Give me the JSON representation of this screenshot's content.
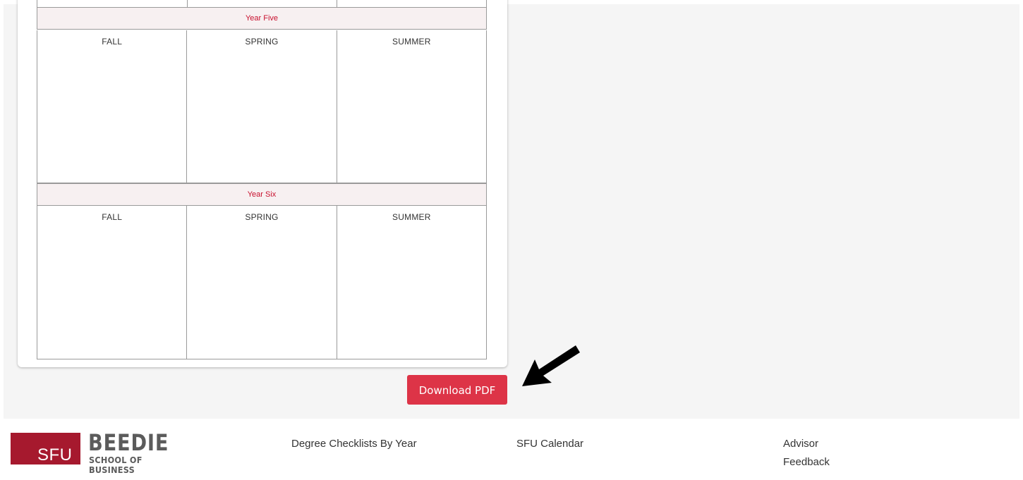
{
  "planner": {
    "years": [
      {
        "label": "Year Five",
        "terms": [
          "FALL",
          "SPRING",
          "SUMMER"
        ]
      },
      {
        "label": "Year Six",
        "terms": [
          "FALL",
          "SPRING",
          "SUMMER"
        ]
      }
    ]
  },
  "actions": {
    "download_label": "Download PDF"
  },
  "footer": {
    "logo": {
      "block_text": "SFU",
      "name": "BEEDIE",
      "subtitle": "SCHOOL OF BUSINESS"
    },
    "links": {
      "degree_checklists": "Degree Checklists By Year",
      "sfu_calendar": "SFU Calendar",
      "advisor": "Advisor",
      "feedback": "Feedback"
    }
  },
  "colors": {
    "accent": "#c8102e",
    "button": "#dd3447",
    "logo_red": "#a6192e",
    "header_bg": "#f7f0f1"
  },
  "icons": {
    "annotation": "arrow-pointer-icon"
  }
}
